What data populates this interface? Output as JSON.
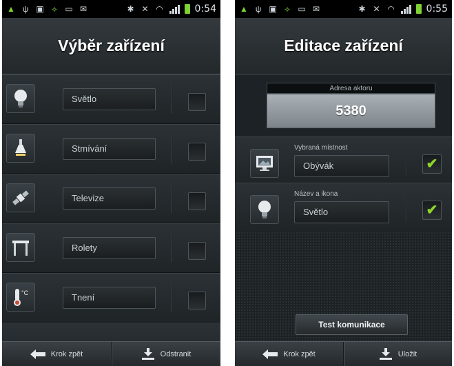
{
  "status_left": {
    "time": "0:54"
  },
  "status_right": {
    "time": "0:55"
  },
  "left_screen": {
    "title": "Výběr zařízení",
    "devices": [
      {
        "label": "Světlo",
        "icon": "lightbulb-icon",
        "checked": false
      },
      {
        "label": "Stmívání",
        "icon": "dimmer-lamp-icon",
        "checked": false
      },
      {
        "label": "Televize",
        "icon": "satellite-icon",
        "checked": false
      },
      {
        "label": "Rolety",
        "icon": "blinds-icon",
        "checked": false
      },
      {
        "label": "Tnení",
        "icon": "thermometer-icon",
        "checked": false
      }
    ],
    "nav": {
      "back_label": "Krok zpět",
      "delete_label": "Odstranit"
    }
  },
  "right_screen": {
    "title": "Editace zařízení",
    "address": {
      "label": "Adresa aktoru",
      "value": "5380"
    },
    "room": {
      "caption": "Vybraná místnost",
      "value": "Obývák",
      "checked": true
    },
    "name_icon": {
      "caption": "Název a ikona",
      "value": "Světlo",
      "checked": true
    },
    "test_button": "Test komunikace",
    "nav": {
      "back_label": "Krok zpět",
      "save_label": "Uložit"
    }
  },
  "colors": {
    "check_green": "#8fd42a",
    "status_green": "#7fd233"
  }
}
